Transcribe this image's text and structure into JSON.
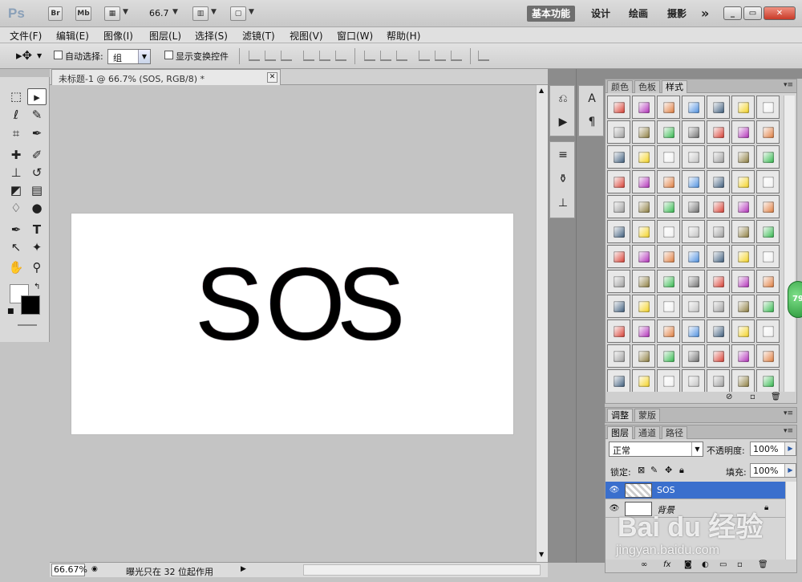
{
  "appbar": {
    "logo": "Ps",
    "br": "Br",
    "mb": "Mb",
    "zoom": "66.7",
    "workspaces": [
      "基本功能",
      "设计",
      "绘画",
      "摄影"
    ],
    "more": "»"
  },
  "menu": [
    "文件(F)",
    "编辑(E)",
    "图像(I)",
    "图层(L)",
    "选择(S)",
    "滤镜(T)",
    "视图(V)",
    "窗口(W)",
    "帮助(H)"
  ],
  "options": {
    "auto_select_label": "自动选择:",
    "auto_select_value": "组",
    "show_transform_label": "显示变换控件"
  },
  "document": {
    "tab_title": "未标题-1 @ 66.7% (SOS, RGB/8) *",
    "text": [
      "S",
      "O",
      "S"
    ]
  },
  "status": {
    "zoom": "66.67%",
    "message": "曝光只在 32 位起作用"
  },
  "swatch_panel": {
    "tabs": [
      "颜色",
      "色板",
      "样式"
    ]
  },
  "adjust_panel": {
    "tabs": [
      "调整",
      "蒙版"
    ]
  },
  "layers_panel": {
    "tabs": [
      "图层",
      "通道",
      "路径"
    ],
    "blend_mode": "正常",
    "opacity_label": "不透明度:",
    "opacity": "100%",
    "lock_label": "锁定:",
    "fill_label": "填充:",
    "fill": "100%",
    "layers": [
      {
        "name": "SOS",
        "selected": true
      },
      {
        "name": "背景",
        "selected": false
      }
    ]
  },
  "badge": "79",
  "watermark": {
    "brand": "Bai du 经验",
    "url": "jingyan.baidu.com"
  },
  "colors": {
    "selection": "#3a6fcd",
    "text_fill": "#1f1e2e"
  }
}
